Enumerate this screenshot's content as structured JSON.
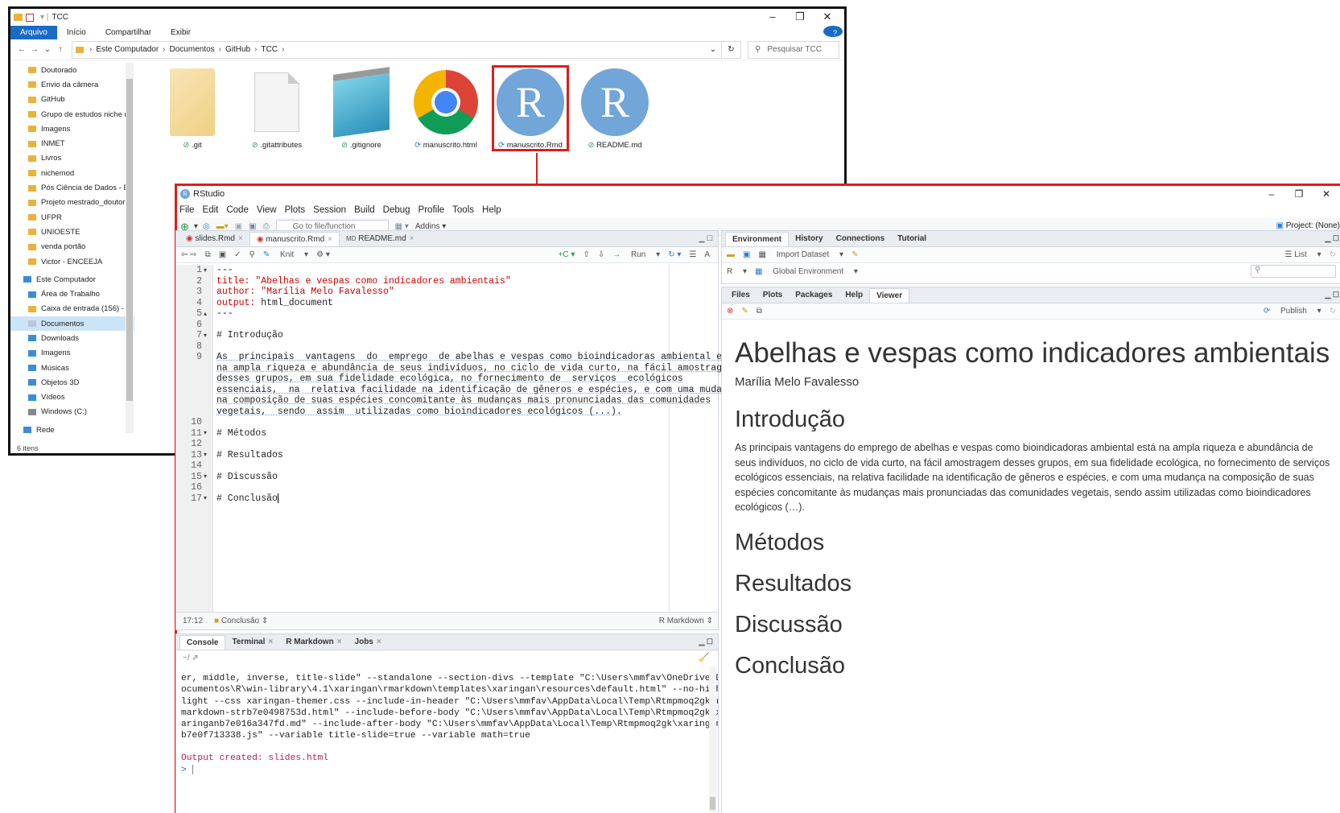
{
  "explorer": {
    "title": "TCC",
    "ribbon": [
      "Arquivo",
      "Início",
      "Compartilhar",
      "Exibir"
    ],
    "breadcrumb": [
      "Este Computador",
      "Documentos",
      "GitHub",
      "TCC"
    ],
    "search_placeholder": "Pesquisar TCC",
    "sidebar": [
      "Doutorado",
      "Envio da câmera",
      "GitHub",
      "Grupo de estudos niche r",
      "Imagens",
      "INMET",
      "Livros",
      "nichemod",
      "Pós Ciência de Dados - B",
      "Projeto mestrado_doutor",
      "UFPR",
      "UNIOESTE",
      "venda portão",
      "Victor - ENCEEJA",
      "Este Computador",
      "Área de Trabalho",
      "Caixa de entrada (156) - i",
      "Documentos",
      "Downloads",
      "Imagens",
      "Músicas",
      "Objetos 3D",
      "Vídeos",
      "Windows (C:)",
      "Rede"
    ],
    "status": "6 itens",
    "files": [
      {
        "name": ".git",
        "icon": "folder-icon"
      },
      {
        "name": ".gitattributes",
        "icon": "document-icon"
      },
      {
        "name": ".gitignore",
        "icon": "notepad-icon"
      },
      {
        "name": "manuscrito.html",
        "icon": "chrome-icon"
      },
      {
        "name": "manuscrito.Rmd",
        "icon": "r-logo-icon"
      },
      {
        "name": "README.md",
        "icon": "r-logo-icon"
      }
    ]
  },
  "rstudio": {
    "title": "RStudio",
    "menu": [
      "File",
      "Edit",
      "Code",
      "View",
      "Plots",
      "Session",
      "Build",
      "Debug",
      "Profile",
      "Tools",
      "Help"
    ],
    "goto_placeholder": "Go to file/function",
    "addins": "Addins",
    "project": "Project: (None)",
    "editor_tabs": [
      "slides.Rmd",
      "manuscrito.Rmd",
      "README.md"
    ],
    "editor_toolbar": {
      "knit": "Knit",
      "run": "Run"
    },
    "code_lines": [
      "---",
      "title: \"Abelhas e vespas como indicadores ambientais\"",
      "author: \"Marília Melo Favalesso\"",
      "output: html_document",
      "---",
      "",
      "# Introdução",
      "",
      "As  principais  vantagens  do  emprego  de abelhas e vespas como bioindicadoras ambiental está",
      "na ampla riqueza e abundância de seus indivíduos, no ciclo de vida curto, na fácil amostragem",
      "desses grupos, em sua fidelidade ecológica, no fornecimento de  serviços  ecológicos",
      "essenciais,  na  relativa facilidade na identificação de gêneros e espécies, e com uma mudança",
      "na composição de suas espécies concomitante às mudanças mais pronunciadas das comunidades",
      "vegetais,  sendo  assim  utilizadas como bioindicadores ecológicos (...).",
      "",
      "# Métodos",
      "",
      "# Resultados",
      "",
      "# Discussão",
      "",
      "# Conclusão"
    ],
    "line_numbers": [
      "1",
      "2",
      "3",
      "4",
      "5",
      "6",
      "7",
      "8",
      "9",
      "",
      "",
      "",
      "",
      "",
      "10",
      "11",
      "12",
      "13",
      "14",
      "15",
      "16",
      "17"
    ],
    "editor_status": {
      "position": "17:12",
      "section": "Conclusão",
      "mode": "R Markdown"
    },
    "console_tabs": [
      "Console",
      "Terminal",
      "R Markdown",
      "Jobs"
    ],
    "console_path": "~/",
    "console_lines": [
      "er, middle, inverse, title-slide\" --standalone --section-divs --template \"C:\\Users\\mmfav\\OneDrive\\D",
      "ocumentos\\R\\win-library\\4.1\\xaringan\\rmarkdown\\templates\\xaringan\\resources\\default.html\" --no-high",
      "light --css xaringan-themer.css --include-in-header \"C:\\Users\\mmfav\\AppData\\Local\\Temp\\Rtmpmoq2gk\\r",
      "markdown-strb7e0498753d.html\" --include-before-body \"C:\\Users\\mmfav\\AppData\\Local\\Temp\\Rtmpmoq2gk\\x",
      "aringanb7e016a347fd.md\" --include-after-body \"C:\\Users\\mmfav\\AppData\\Local\\Temp\\Rtmpmoq2gk\\xaringan",
      "b7e0f713338.js\" --variable title-slide=true --variable math=true"
    ],
    "console_output": "Output created: slides.html",
    "console_prompt": ">",
    "env_tabs": [
      "Environment",
      "History",
      "Connections",
      "Tutorial"
    ],
    "env_toolbar": {
      "import": "Import Dataset",
      "list": "List",
      "lang": "R",
      "scope": "Global Environment"
    },
    "files_tabs": [
      "Files",
      "Plots",
      "Packages",
      "Help",
      "Viewer"
    ],
    "publish": "Publish",
    "viewer": {
      "title": "Abelhas e vespas como indicadores ambientais",
      "author": "Marília Melo Favalesso",
      "h_intro": "Introdução",
      "paragraph": "As principais vantagens do emprego de abelhas e vespas como bioindicadoras ambiental está na ampla riqueza e abundância de seus indivíduos, no ciclo de vida curto, na fácil amostragem desses grupos, em sua fidelidade ecológica, no fornecimento de serviços ecológicos essenciais, na relativa facilidade na identificação de gêneros e espécies, e com uma mudança na composição de suas espécies concomitante às mudanças mais pronunciadas das comunidades vegetais, sendo assim utilizadas como bioindicadores ecológicos (…).",
      "sections": [
        "Métodos",
        "Resultados",
        "Discussão",
        "Conclusão"
      ]
    }
  }
}
